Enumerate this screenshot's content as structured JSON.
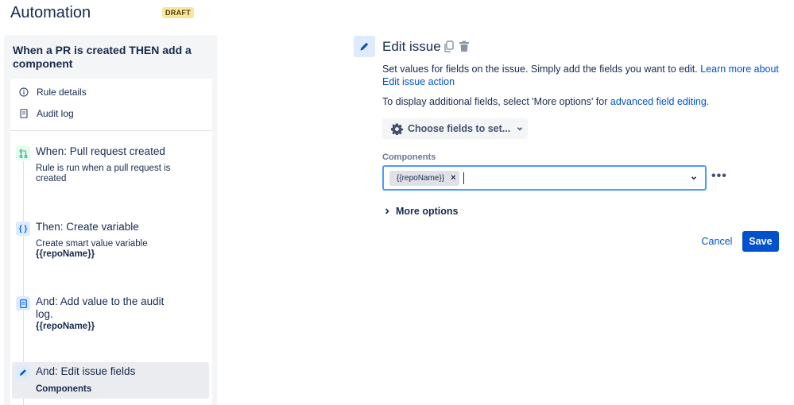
{
  "header": {
    "title": "Automation",
    "badge": "DRAFT"
  },
  "rule": {
    "name": "When a PR is created THEN add a component",
    "nav": [
      {
        "label": "Rule details",
        "icon": "info-icon"
      },
      {
        "label": "Audit log",
        "icon": "document-icon"
      }
    ],
    "steps": [
      {
        "title": "When: Pull request created",
        "description": "Rule is run when a pull request is created",
        "bold": "",
        "icon": "pull-request-icon",
        "icon_color": "#36b37e"
      },
      {
        "title": "Then: Create variable",
        "description": "Create smart value variable",
        "bold": "{{repoName}}",
        "icon": "braces-icon",
        "icon_color": "#0065ff"
      },
      {
        "title": "And: Add value to the audit log.",
        "description": "",
        "bold": "{{repoName}}",
        "icon": "document-icon",
        "icon_color": "#0065ff"
      },
      {
        "title": "And: Edit issue fields",
        "description": "",
        "bold": "Components",
        "icon": "pencil-icon",
        "icon_color": "#0065ff"
      }
    ]
  },
  "editor": {
    "title": "Edit issue",
    "description": "Set values for fields on the issue. Simply add the fields you want to edit.",
    "learn_more_link": "Learn more about Edit issue action",
    "display_text": "To display additional fields, select 'More options' for",
    "advanced_link": "advanced field editing.",
    "choose_fields_label": "Choose fields to set...",
    "components_label": "Components",
    "components_value": "{{repoName}}",
    "tag_remove": "×",
    "more_options_label": "More options",
    "more_dots": "•••",
    "cancel_label": "Cancel",
    "save_label": "Save"
  },
  "colors": {
    "primary": "#0052cc",
    "focus_border": "#4c9aff",
    "draft_badge_bg": "#f8e6a0"
  }
}
